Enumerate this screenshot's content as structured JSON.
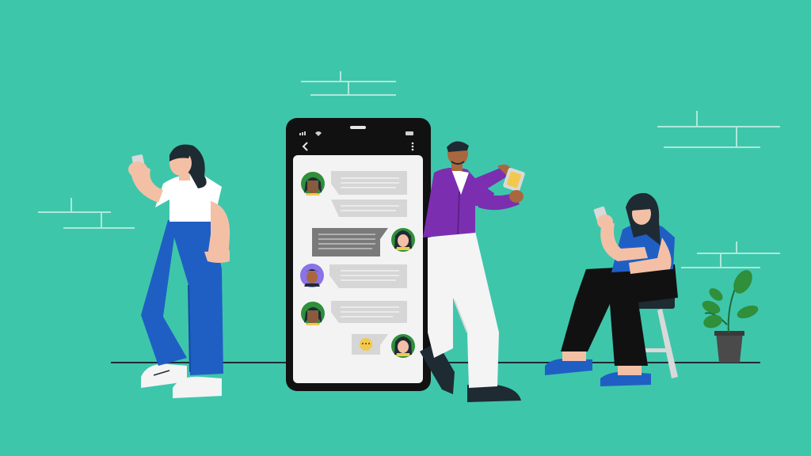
{
  "scene": {
    "background_color": "#3ec6ab",
    "accent_purple": "#7b2fb0",
    "accent_blue": "#1f5fc4",
    "phone_frame_color": "#111111"
  },
  "phone": {
    "status_icons": [
      "signal-icon",
      "wifi-icon",
      "battery-icon"
    ],
    "header_icons": [
      "back-arrow-icon",
      "more-vert-icon"
    ],
    "messages": [
      {
        "side": "left",
        "avatar": "woman-curly-hair-avatar"
      },
      {
        "side": "right",
        "avatar": "woman-black-hair-avatar"
      },
      {
        "side": "left",
        "avatar": "man-purple-avatar"
      },
      {
        "side": "left",
        "avatar": "woman-curly-hair-avatar"
      },
      {
        "side": "right",
        "avatar": "woman-black-hair-avatar",
        "content": "emoji-icon"
      }
    ]
  },
  "people": [
    {
      "name": "standing-woman",
      "description_icon": "person-icon"
    },
    {
      "name": "leaning-man",
      "description_icon": "person-icon"
    },
    {
      "name": "sitting-woman",
      "description_icon": "person-icon"
    }
  ],
  "decor": [
    "brick-lines",
    "potted-plant-icon",
    "stool"
  ]
}
